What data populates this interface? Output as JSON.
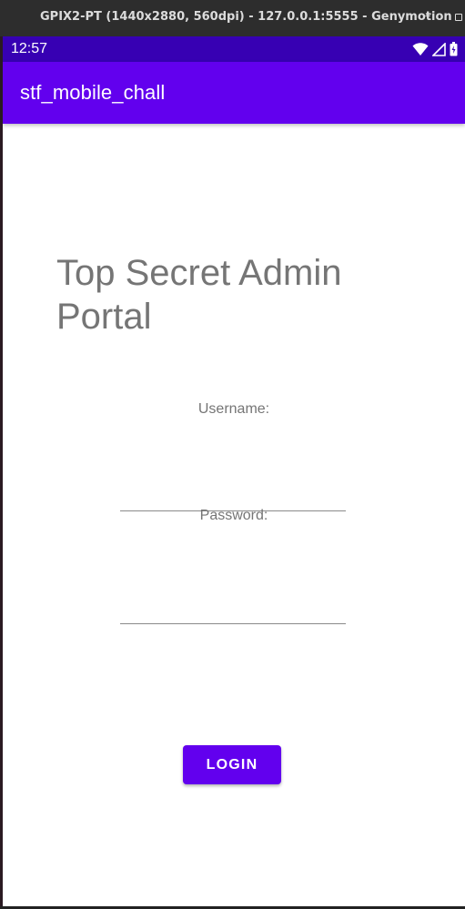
{
  "window": {
    "title": "GPIX2-PT (1440x2880, 560dpi) - 127.0.0.1:5555 - Genymotion",
    "minimize_symbol": "–"
  },
  "status_bar": {
    "time": "12:57",
    "icons": [
      "wifi-icon",
      "cell-signal-icon",
      "battery-icon"
    ],
    "color": "#3700b3"
  },
  "app_bar": {
    "title": "stf_mobile_chall",
    "color": "#6200ee"
  },
  "login_form": {
    "heading": "Top Secret Admin Portal",
    "username_label": "Username:",
    "username_value": "",
    "password_label": "Password:",
    "password_value": "",
    "login_button_label": "LOGIN",
    "button_color": "#6200ee"
  }
}
